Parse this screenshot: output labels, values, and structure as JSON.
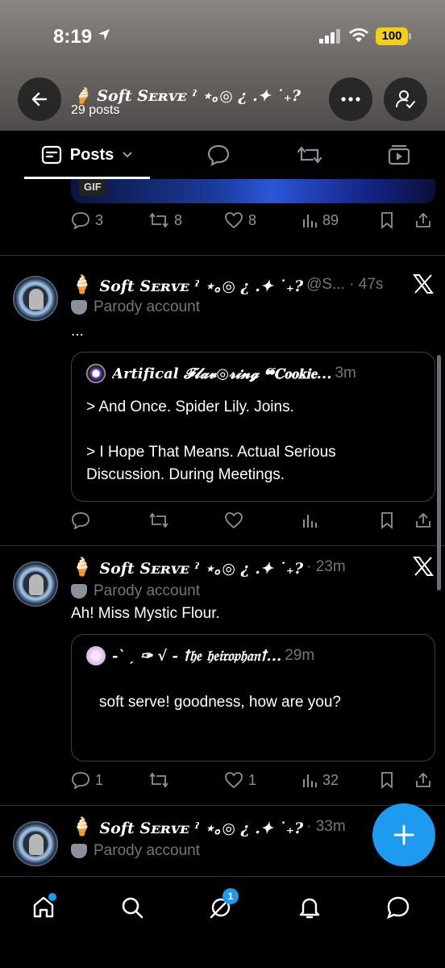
{
  "status_bar": {
    "time": "8:19",
    "battery": "100"
  },
  "header": {
    "profile_name": "🍦 𝑺𝒐𝒇𝒕 Sᴇʀᴠᴇ ˀ ⋆｡◎ ¿ .✦ ˙₊?",
    "post_count": "29 posts"
  },
  "tabs": {
    "posts_label": "Posts"
  },
  "feed": {
    "gif_badge": "GIF",
    "top_post_actions": {
      "replies": "3",
      "reposts": "8",
      "likes": "8",
      "views": "89"
    },
    "posts": [
      {
        "name": "𝑺𝒐𝒇𝒕 Sᴇʀᴠᴇ ˀ ⋆｡◎ ¿ .✦ ˙₊?",
        "handle_time": "@S... · 47s",
        "parody_label": "Parody account",
        "text": "...",
        "quote": {
          "name": "𝑨𝒓𝒕𝒊𝒇𝒊𝒄𝒂𝒍 𝓕𝓵𝓪𝓿◎𝓻𝓲𝓷𝓰 ❝𝐂𝐨𝐨𝐤𝐢𝐞...",
          "time": "3m",
          "line1": "> And Once. Spider Lily. Joins.",
          "line2": "> I Hope That Means. Actual Serious",
          "line3": "Discussion. During Meetings."
        },
        "actions": {
          "replies": "",
          "reposts": "",
          "likes": "",
          "views": ""
        }
      },
      {
        "name": "𝑺𝒐𝒇𝒕 Sᴇʀᴠᴇ ˀ ⋆｡◎ ¿ .✦ ˙₊?",
        "handle_time": "· 23m",
        "parody_label": "Parody account",
        "text": "Ah! Miss Mystic Flour.",
        "quote": {
          "name": "-ˋ ˏ ✑ √ - ꝉ𝔥𝔢 𝔥𝔢𝔦𝔯𝔬𝔭𝔥𝔞𝔫ꝉ...",
          "time": "29m",
          "line1": "soft serve! goodness, how are you?"
        },
        "actions": {
          "replies": "1",
          "reposts": "",
          "likes": "1",
          "views": "32"
        }
      },
      {
        "name": "𝑺𝒐𝒇𝒕 Sᴇʀᴠᴇ ˀ ⋆｡◎ ¿ .✦ ˙₊?",
        "handle_time": "· 33m",
        "parody_label": "Parody account"
      }
    ]
  },
  "bottom_nav": {
    "notification_badge": "1"
  },
  "colors": {
    "accent": "#1d9bf0",
    "muted": "#71767b",
    "background": "#000000",
    "battery": "#f1d016"
  }
}
